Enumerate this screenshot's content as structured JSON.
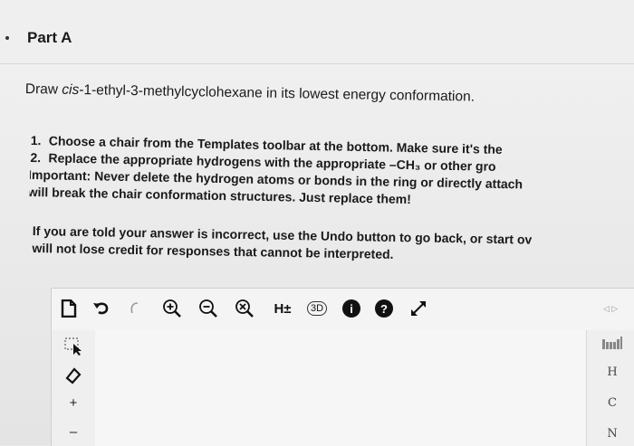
{
  "part": {
    "title": "Part A"
  },
  "question": {
    "prefix": "Draw ",
    "italic": "cis",
    "suffix": "-1-ethyl-3-methylcyclohexane in its lowest energy conformation."
  },
  "instructions": [
    {
      "num": "1.",
      "text": "Choose a chair from the Templates toolbar at the bottom. Make sure it's the"
    },
    {
      "num": "2.",
      "text": "Replace the appropriate hydrogens with the appropriate –CH₃ or other gro"
    },
    {
      "num": "",
      "text": "Important: Never delete the hydrogen atoms or bonds in the ring or directly attach"
    },
    {
      "num": "",
      "text": "will break the chair conformation structures. Just replace them!"
    }
  ],
  "note": [
    "If you are told your answer is incorrect, use the Undo button to go back, or start ov",
    "will not lose credit for responses that cannot be interpreted."
  ],
  "toolbar": {
    "hydrogen_label": "H±",
    "three_d_label": "3D",
    "info_label": "i",
    "help_label": "?"
  },
  "right_panel": {
    "items": [
      "H",
      "C",
      "N"
    ],
    "top_label": "◁ ▷"
  },
  "left_panel": {
    "plus_label": "+",
    "minus_label": "–"
  }
}
